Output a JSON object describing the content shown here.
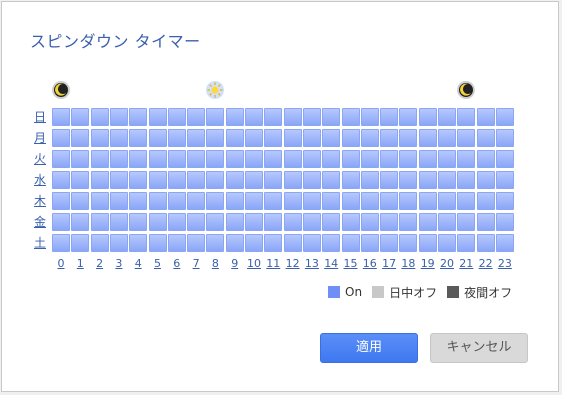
{
  "dialog": {
    "title": "スピンダウン タイマー"
  },
  "days": [
    "日",
    "月",
    "火",
    "水",
    "木",
    "金",
    "土"
  ],
  "hours": [
    "0",
    "1",
    "2",
    "3",
    "4",
    "5",
    "6",
    "7",
    "8",
    "9",
    "10",
    "11",
    "12",
    "13",
    "14",
    "15",
    "16",
    "17",
    "18",
    "19",
    "20",
    "21",
    "22",
    "23"
  ],
  "icons": [
    {
      "name": "moon-icon",
      "hour": 0
    },
    {
      "name": "sun-icon",
      "hour": 8
    },
    {
      "name": "moon-icon",
      "hour": 21
    }
  ],
  "legend": {
    "on_label": "On",
    "day_off_label": "日中オフ",
    "night_off_label": "夜間オフ",
    "on_color": "#6f8ff7",
    "day_off_color": "#c8c8c8",
    "night_off_color": "#5a5a5a"
  },
  "buttons": {
    "apply_label": "適用",
    "cancel_label": "キャンセル"
  },
  "schedule_state": "all-on"
}
